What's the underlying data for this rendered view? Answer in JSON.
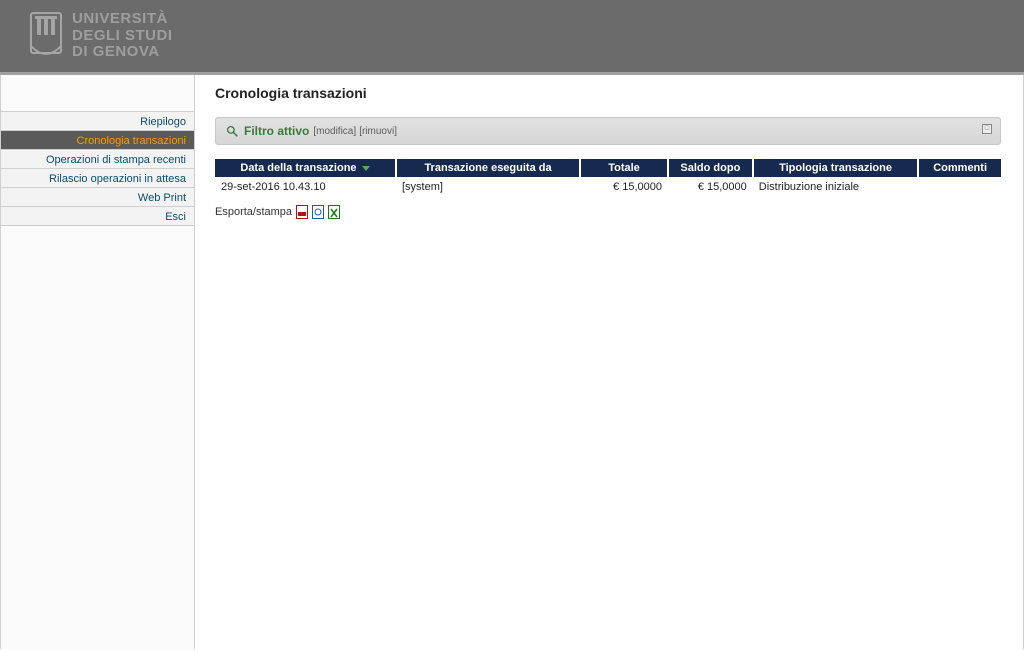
{
  "brand": {
    "line1": "UNIVERSITÀ",
    "line2": "DEGLI STUDI",
    "line3": "DI GENOVA"
  },
  "sidebar": {
    "items": [
      {
        "label": "Riepilogo",
        "active": false
      },
      {
        "label": "Cronologia transazioni",
        "active": true
      },
      {
        "label": "Operazioni di stampa recenti",
        "active": false
      },
      {
        "label": "Rilascio operazioni in attesa",
        "active": false
      },
      {
        "label": "Web Print",
        "active": false
      },
      {
        "label": "Esci",
        "active": false
      }
    ]
  },
  "page": {
    "title": "Cronologia transazioni"
  },
  "filter": {
    "label": "Filtro attivo",
    "modify": "[modifica]",
    "remove": "[rimuovi]"
  },
  "table": {
    "headers": {
      "date": "Data della transazione",
      "by": "Transazione eseguita da",
      "total": "Totale",
      "balance": "Saldo dopo",
      "type": "Tipologia transazione",
      "comments": "Commenti"
    },
    "rows": [
      {
        "date": "29-set-2016 10.43.10",
        "by": "[system]",
        "total": "€ 15,0000",
        "balance": "€ 15,0000",
        "type": "Distribuzione iniziale",
        "comments": ""
      }
    ]
  },
  "export": {
    "label": "Esporta/stampa"
  }
}
